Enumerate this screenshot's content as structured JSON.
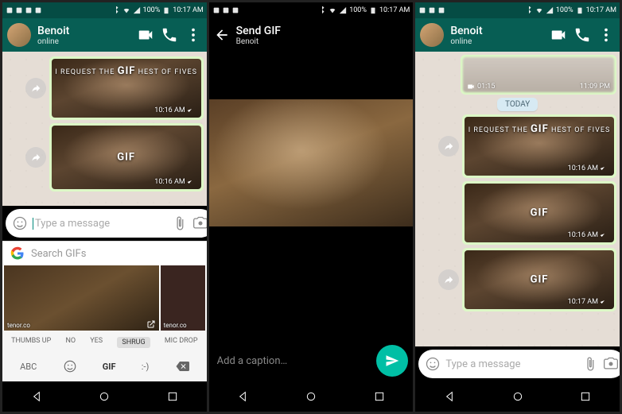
{
  "status": {
    "battery": "100%",
    "time": "10:17 AM"
  },
  "contact": {
    "name": "Benoit",
    "presence": "online"
  },
  "s1": {
    "msgs": [
      {
        "overlay": "I REQUEST THE",
        "overlay2": "HEST OF FIVES",
        "badge": "GIF",
        "time": "10:16 AM"
      },
      {
        "badge": "GIF",
        "time": "10:16 AM"
      }
    ],
    "input_placeholder": "Type a message",
    "gif_search_placeholder": "Search GIFs",
    "thumb_source": "tenor.co",
    "categories": [
      "THUMBS UP",
      "NO",
      "YES",
      "SHRUG",
      "MIC DROP"
    ],
    "selected_category": "SHRUG",
    "kb": {
      "abc": "ABC",
      "gif": "GIF",
      "emote": ":-)"
    }
  },
  "s2": {
    "title": "Send GIF",
    "subtitle": "Benoit",
    "caption_placeholder": "Add a caption…"
  },
  "s3": {
    "video": {
      "duration": "01:15",
      "time": "11:09 PM"
    },
    "date_chip": "TODAY",
    "msgs": [
      {
        "overlay": "I REQUEST THE",
        "overlay2": "HEST OF FIVES",
        "badge": "GIF",
        "time": "10:16 AM"
      },
      {
        "badge": "GIF",
        "time": "10:16 AM"
      },
      {
        "badge": "GIF",
        "time": "10:17 AM"
      }
    ],
    "input_placeholder": "Type a message"
  }
}
